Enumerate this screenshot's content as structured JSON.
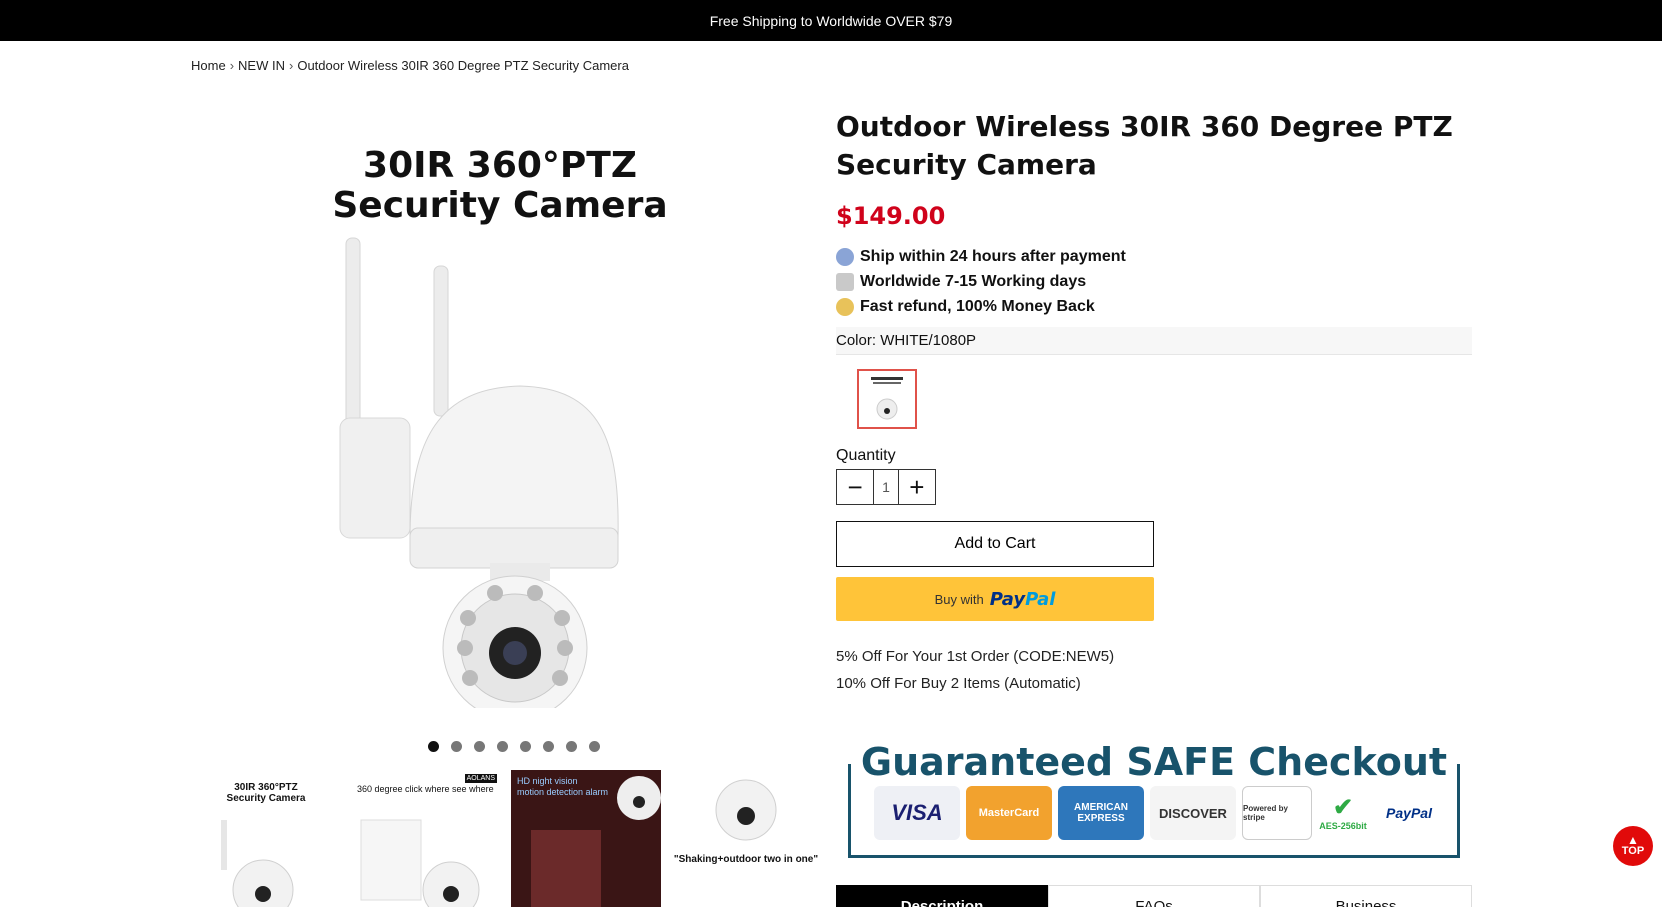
{
  "announcement": "Free Shipping to Worldwide OVER $79",
  "breadcrumb": {
    "home": "Home",
    "category": "NEW IN",
    "current": "Outdoor Wireless 30IR 360 Degree PTZ Security Camera",
    "separator": "›"
  },
  "gallery": {
    "main_title_line1": "30IR 360°PTZ",
    "main_title_line2": "Security Camera",
    "dot_count": 8,
    "active_dot": 0,
    "thumbs": [
      {
        "title_line1": "30IR 360°PTZ",
        "title_line2": "Security Camera"
      },
      {
        "title": "360 degree click  where see where",
        "brand": "AOLANS"
      },
      {
        "title_line1": "HD night vision",
        "title_line2": "motion detection alarm"
      },
      {
        "caption": "\"Shaking+outdoor  two in one\""
      }
    ]
  },
  "product": {
    "title_line1": "Outdoor Wireless 30IR 360 Degree PTZ",
    "title_line2": "Security Camera",
    "price": "$149.00",
    "features": [
      {
        "icon": "truck-icon",
        "text": "Ship within 24 hours after payment"
      },
      {
        "icon": "cart-icon",
        "text": "Worldwide 7-15 Working days"
      },
      {
        "icon": "money-back-icon",
        "text": "Fast refund, 100% Money Back"
      }
    ],
    "color_label": "Color:",
    "color_value": "WHITE/1080P",
    "quantity_label": "Quantity",
    "quantity": "1",
    "add_to_cart": "Add to Cart",
    "buy_with": "Buy with",
    "paypal_pay": "Pay",
    "paypal_pal": "Pal",
    "promos": [
      "5% Off For Your 1st Order   (CODE:NEW5)",
      "10% Off For Buy 2 Items   (Automatic)"
    ]
  },
  "safe_checkout": {
    "title": "Guaranteed SAFE Checkout",
    "cards": [
      "VISA",
      "MasterCard",
      "AMERICAN EXPRESS",
      "DISCOVER",
      "Powered by stripe",
      "AES-256bit",
      "PayPal"
    ]
  },
  "tabs": [
    "Description",
    "FAQs",
    "Business"
  ],
  "top_button": "TOP",
  "colors": {
    "price": "#d0021b",
    "paypal_bg": "#ffc439",
    "safe": "#18536b",
    "top": "#e10a0a"
  }
}
